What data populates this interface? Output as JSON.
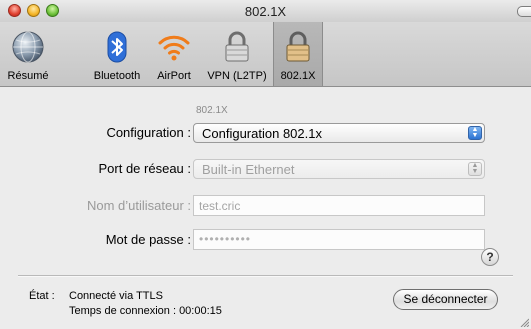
{
  "window": {
    "title": "802.1X"
  },
  "toolbar": {
    "items": [
      {
        "label": "Résumé",
        "icon": "globe-icon"
      },
      {
        "label": "Bluetooth",
        "icon": "bluetooth-icon"
      },
      {
        "label": "AirPort",
        "icon": "airport-icon"
      },
      {
        "label": "VPN (L2TP)",
        "icon": "lock-icon"
      },
      {
        "label": "802.1X",
        "icon": "lock-icon",
        "selected": true
      }
    ]
  },
  "main": {
    "section_caption": "802.1X",
    "configuration": {
      "label": "Configuration :",
      "value": "Configuration 802.1x"
    },
    "port": {
      "label": "Port de réseau :",
      "value": "Built-in Ethernet"
    },
    "username": {
      "label": "Nom d’utilisateur :",
      "value": "test.cric"
    },
    "password": {
      "label": "Mot de passe :",
      "value": "••••••••••"
    },
    "help": "?"
  },
  "status": {
    "key": "État :",
    "value": "Connecté via TTLS",
    "time": "Temps de connexion : 00:00:15",
    "disconnect_label": "Se déconnecter"
  },
  "colors": {
    "accent": "#2c73d2",
    "window_bg": "#ececec"
  }
}
